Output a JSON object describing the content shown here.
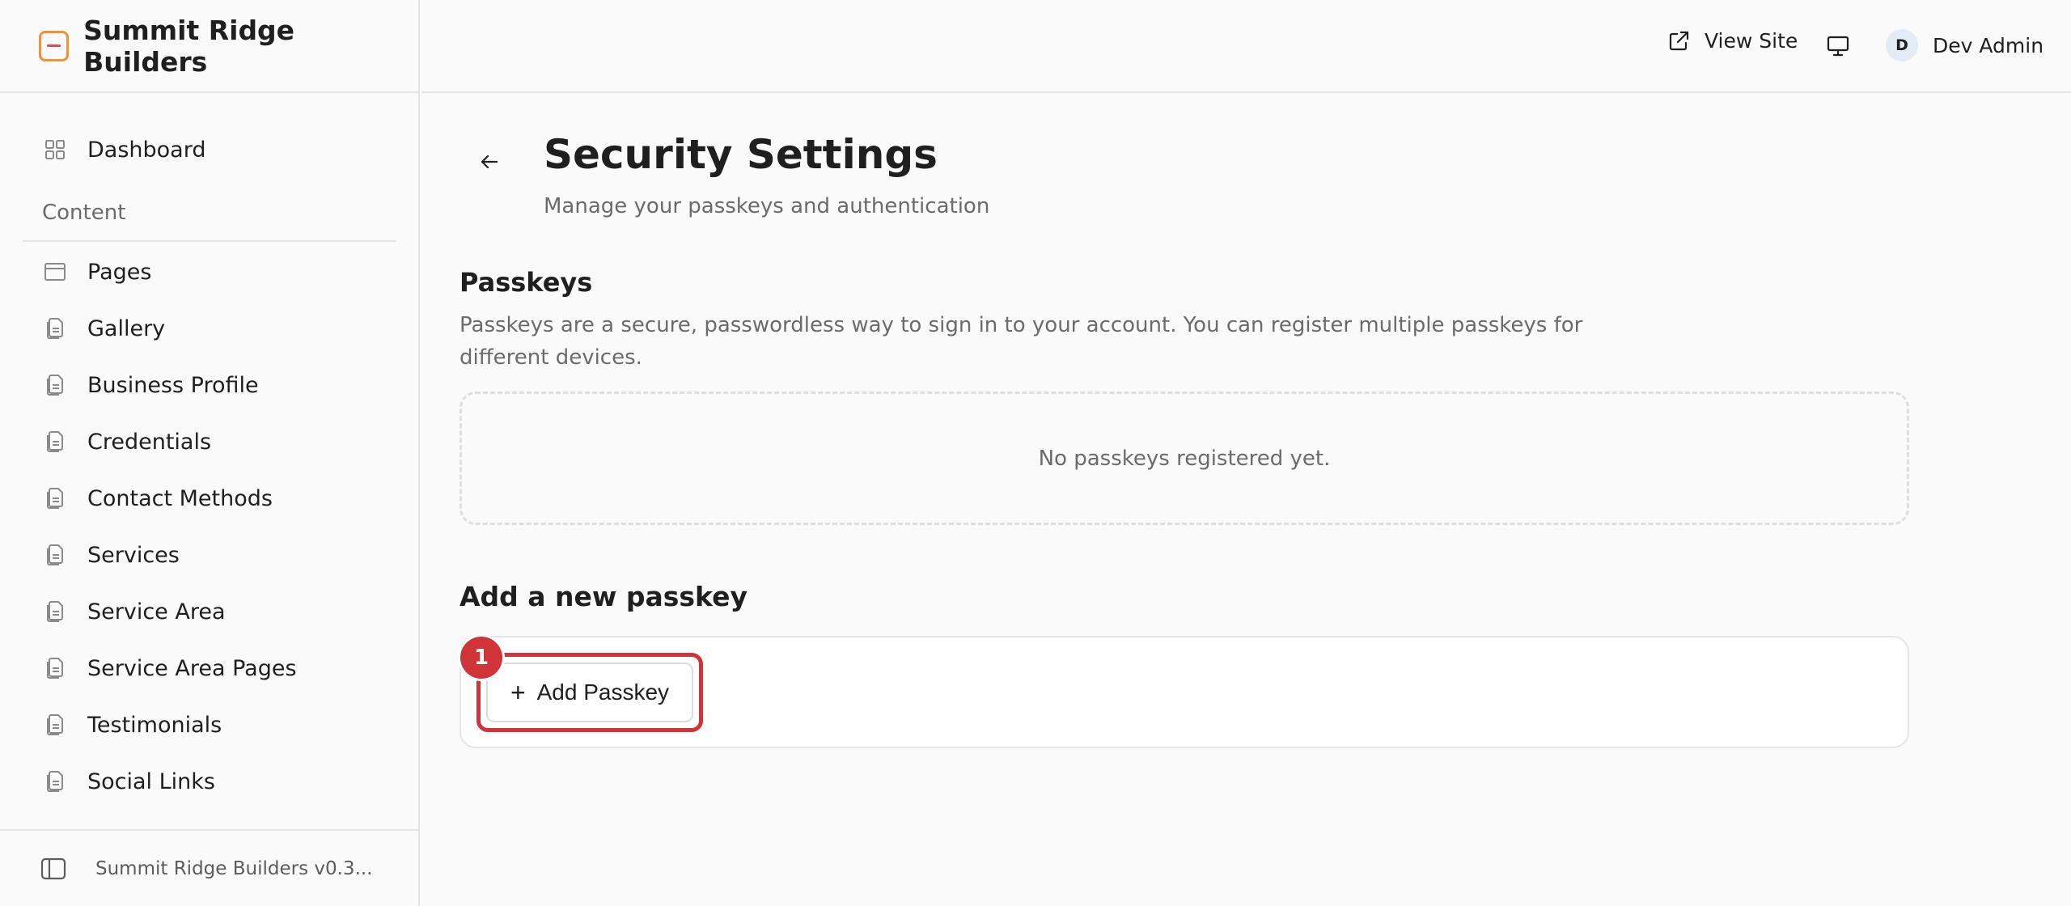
{
  "brand": {
    "name": "Summit Ridge Builders",
    "logo_color": "#f29233",
    "logo_accent": "#e5484d"
  },
  "sidebar": {
    "dashboard": {
      "label": "Dashboard",
      "icon": "grid-icon"
    },
    "section_label": "Content",
    "items": [
      {
        "label": "Pages",
        "icon": "browser-window-icon"
      },
      {
        "label": "Gallery",
        "icon": "documents-icon"
      },
      {
        "label": "Business Profile",
        "icon": "documents-icon"
      },
      {
        "label": "Credentials",
        "icon": "documents-icon"
      },
      {
        "label": "Contact Methods",
        "icon": "documents-icon"
      },
      {
        "label": "Services",
        "icon": "documents-icon"
      },
      {
        "label": "Service Area",
        "icon": "documents-icon"
      },
      {
        "label": "Service Area Pages",
        "icon": "documents-icon"
      },
      {
        "label": "Testimonials",
        "icon": "documents-icon"
      },
      {
        "label": "Social Links",
        "icon": "documents-icon"
      }
    ],
    "footer_text": "Summit Ridge Builders v0.3..."
  },
  "topbar": {
    "view_site_label": "View Site",
    "user_initial": "D",
    "user_name": "Dev Admin"
  },
  "main": {
    "title": "Security Settings",
    "subtitle": "Manage your passkeys and authentication",
    "passkeys": {
      "title": "Passkeys",
      "description": "Passkeys are a secure, passwordless way to sign in to your account. You can register multiple passkeys for different devices.",
      "empty_text": "No passkeys registered yet."
    },
    "add": {
      "title": "Add a new passkey",
      "button_plus": "+",
      "button_label": "Add Passkey",
      "badge": "1"
    }
  },
  "colors": {
    "highlight": "#d13438",
    "border": "#e5e5e5",
    "muted_text": "#6b6b6b"
  }
}
